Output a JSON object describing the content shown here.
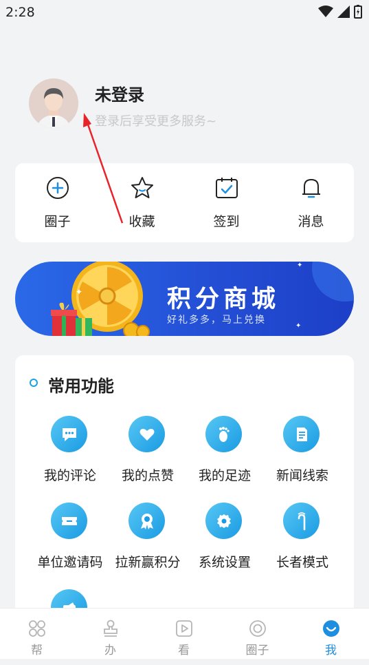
{
  "status_bar": {
    "time": "2:28"
  },
  "profile": {
    "name": "未登录",
    "subtitle": "登录后享受更多服务~"
  },
  "quick_actions": [
    {
      "label": "圈子",
      "icon": "plus-circle-icon"
    },
    {
      "label": "收藏",
      "icon": "star-icon"
    },
    {
      "label": "签到",
      "icon": "calendar-check-icon"
    },
    {
      "label": "消息",
      "icon": "bell-icon"
    }
  ],
  "banner": {
    "title": "积分商城",
    "subtitle": "好礼多多，马上兑换"
  },
  "functions": {
    "title": "常用功能",
    "items": [
      {
        "label": "我的评论",
        "icon": "comment-icon"
      },
      {
        "label": "我的点赞",
        "icon": "heart-icon"
      },
      {
        "label": "我的足迹",
        "icon": "footprint-icon"
      },
      {
        "label": "新闻线索",
        "icon": "document-icon"
      },
      {
        "label": "单位邀请码",
        "icon": "ticket-icon"
      },
      {
        "label": "拉新赢积分",
        "icon": "badge-icon"
      },
      {
        "label": "系统设置",
        "icon": "gear-icon"
      },
      {
        "label": "长者模式",
        "icon": "cane-icon"
      },
      {
        "label": "",
        "icon": "card-icon"
      }
    ]
  },
  "tabbar": [
    {
      "label": "帮",
      "icon": "grid-icon",
      "active": false
    },
    {
      "label": "办",
      "icon": "stamp-icon",
      "active": false
    },
    {
      "label": "看",
      "icon": "play-icon",
      "active": false
    },
    {
      "label": "圈子",
      "icon": "circle-icon",
      "active": false
    },
    {
      "label": "我",
      "icon": "smile-icon",
      "active": true
    }
  ],
  "colors": {
    "accent": "#1e8fe0",
    "banner": "#2450d6",
    "annotation": "#e8232a"
  }
}
